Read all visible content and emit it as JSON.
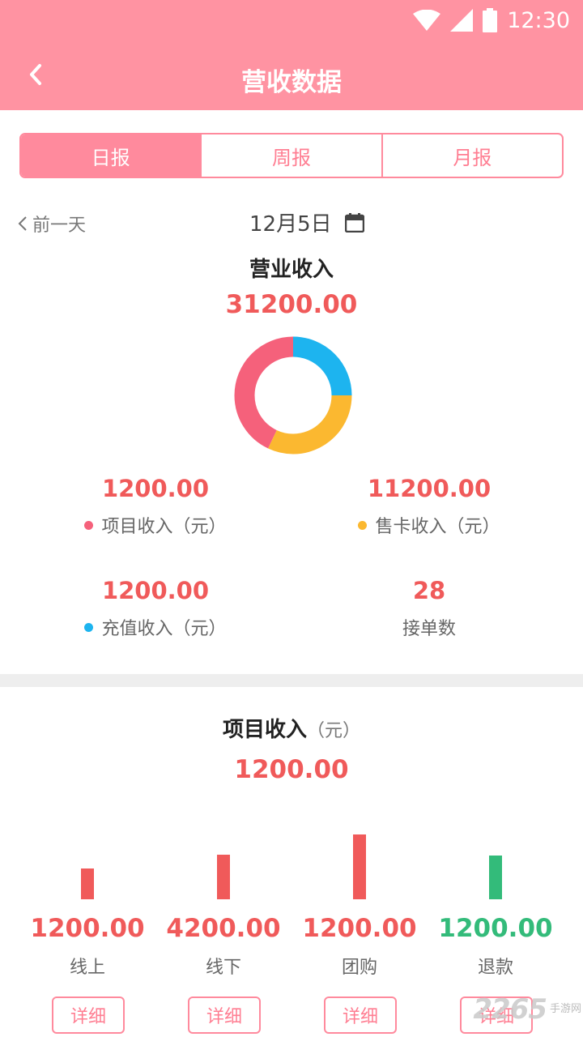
{
  "status_bar": {
    "time": "12:30",
    "icons": [
      "wifi-icon",
      "signal-icon",
      "battery-icon"
    ]
  },
  "header": {
    "title": "营收数据",
    "back_icon": "chevron-left-icon",
    "bg_color": "#ff93a2"
  },
  "tabs": [
    {
      "label": "日报",
      "active": true
    },
    {
      "label": "周报",
      "active": false
    },
    {
      "label": "月报",
      "active": false
    }
  ],
  "date_nav": {
    "prev_label": "前一天",
    "current_date": "12月5日",
    "calendar_icon": "calendar-icon"
  },
  "revenue": {
    "title": "营业收入",
    "total": "31200.00",
    "stats": [
      {
        "value": "1200.00",
        "label": "项目收入（元）",
        "dot_color": "#f5617b"
      },
      {
        "value": "11200.00",
        "label": "售卡收入（元）",
        "dot_color": "#fbb830"
      },
      {
        "value": "1200.00",
        "label": "充值收入（元）",
        "dot_color": "#1db4ef"
      },
      {
        "value": "28",
        "label": "接单数"
      }
    ]
  },
  "donut_chart": {
    "type": "pie",
    "segments": [
      {
        "name": "充值收入",
        "fraction": 0.25,
        "color": "#1db4ef"
      },
      {
        "name": "售卡收入",
        "fraction": 0.32,
        "color": "#fbb830"
      },
      {
        "name": "项目收入",
        "fraction": 0.43,
        "color": "#f5617b"
      }
    ]
  },
  "project_income": {
    "title": "项目收入",
    "unit": "（元）",
    "total": "1200.00",
    "detail_label": "详细",
    "items": [
      {
        "value": "1200.00",
        "label": "线上",
        "level": 0.47,
        "color": "#f05a5a"
      },
      {
        "value": "4200.00",
        "label": "线下",
        "level": 0.69,
        "color": "#f05a5a"
      },
      {
        "value": "1200.00",
        "label": "团购",
        "level": 1.0,
        "color": "#f05a5a"
      },
      {
        "value": "1200.00",
        "label": "退款",
        "level": 0.67,
        "color": "#33bb7a"
      }
    ]
  },
  "watermark": {
    "number": "2265",
    "text": "手游网"
  }
}
